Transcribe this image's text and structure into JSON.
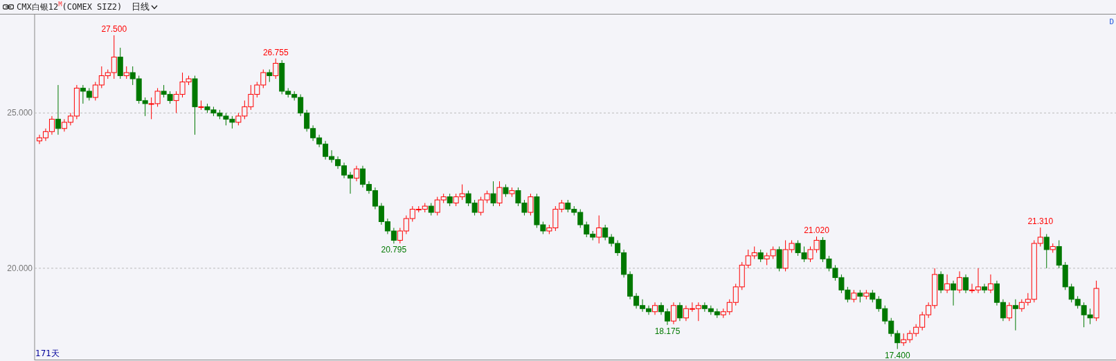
{
  "header": {
    "title": "CMX白银12$^{M}$(COMEX SIZ2)",
    "period": "日线"
  },
  "corner_label": "D",
  "day_count": "171天",
  "chart_data": {
    "type": "candlestick",
    "ylim": [
      17.08,
      28.17
    ],
    "yticks": [
      {
        "value": 25,
        "label": "25.000"
      },
      {
        "value": 20,
        "label": "20.000"
      }
    ],
    "ohlc": [
      [
        24.1,
        24.3,
        24.0,
        24.2
      ],
      [
        24.2,
        24.5,
        24.1,
        24.4
      ],
      [
        24.4,
        24.9,
        24.3,
        24.8
      ],
      [
        24.8,
        25.9,
        24.3,
        24.5
      ],
      [
        24.5,
        24.8,
        24.4,
        24.7
      ],
      [
        24.7,
        25.0,
        24.6,
        24.9
      ],
      [
        24.9,
        25.9,
        24.8,
        25.8
      ],
      [
        25.8,
        25.9,
        25.3,
        25.7
      ],
      [
        25.7,
        25.8,
        25.4,
        25.5
      ],
      [
        25.5,
        26.0,
        25.4,
        25.9
      ],
      [
        25.9,
        26.5,
        25.8,
        26.2
      ],
      [
        26.2,
        26.4,
        26.1,
        26.3
      ],
      [
        26.3,
        27.5,
        26.1,
        26.8
      ],
      [
        26.8,
        27.1,
        26.1,
        26.2
      ],
      [
        26.2,
        26.5,
        26.1,
        26.3
      ],
      [
        26.3,
        26.5,
        25.9,
        26.1
      ],
      [
        26.1,
        26.2,
        25.3,
        25.4
      ],
      [
        25.4,
        25.5,
        24.9,
        25.3
      ],
      [
        25.3,
        25.5,
        24.8,
        25.3
      ],
      [
        25.3,
        25.8,
        25.2,
        25.7
      ],
      [
        25.7,
        25.9,
        25.5,
        25.6
      ],
      [
        25.6,
        25.7,
        25.3,
        25.4
      ],
      [
        25.4,
        25.7,
        25.0,
        25.6
      ],
      [
        25.6,
        26.3,
        25.5,
        26.0
      ],
      [
        26.0,
        26.2,
        25.9,
        26.1
      ],
      [
        26.1,
        26.2,
        24.3,
        25.2
      ],
      [
        25.2,
        25.4,
        25.1,
        25.2
      ],
      [
        25.2,
        25.3,
        25.0,
        25.1
      ],
      [
        25.1,
        25.2,
        24.9,
        25.0
      ],
      [
        25.0,
        25.1,
        24.8,
        24.9
      ],
      [
        24.9,
        25.0,
        24.6,
        24.8
      ],
      [
        24.8,
        24.9,
        24.5,
        24.7
      ],
      [
        24.7,
        25.0,
        24.6,
        24.9
      ],
      [
        24.9,
        25.4,
        24.8,
        25.2
      ],
      [
        25.2,
        25.9,
        25.1,
        25.6
      ],
      [
        25.6,
        26.0,
        25.5,
        25.9
      ],
      [
        25.9,
        26.4,
        25.8,
        26.3
      ],
      [
        26.3,
        26.4,
        26.0,
        26.2
      ],
      [
        26.2,
        26.755,
        26.1,
        26.6
      ],
      [
        26.6,
        26.7,
        25.6,
        25.7
      ],
      [
        25.7,
        25.8,
        25.5,
        25.6
      ],
      [
        25.6,
        25.7,
        25.4,
        25.5
      ],
      [
        25.5,
        25.6,
        24.9,
        25.0
      ],
      [
        25.0,
        25.1,
        24.4,
        24.5
      ],
      [
        24.5,
        24.6,
        24.1,
        24.2
      ],
      [
        24.2,
        24.3,
        23.9,
        24.0
      ],
      [
        24.0,
        24.1,
        23.5,
        23.6
      ],
      [
        23.6,
        23.8,
        23.4,
        23.5
      ],
      [
        23.5,
        23.6,
        23.2,
        23.3
      ],
      [
        23.3,
        23.4,
        22.9,
        23.0
      ],
      [
        23.0,
        23.1,
        22.4,
        22.9
      ],
      [
        22.9,
        23.3,
        22.8,
        23.2
      ],
      [
        23.2,
        23.3,
        22.6,
        22.7
      ],
      [
        22.7,
        22.8,
        22.4,
        22.5
      ],
      [
        22.5,
        22.6,
        21.9,
        22.0
      ],
      [
        22.0,
        22.1,
        21.4,
        21.5
      ],
      [
        21.5,
        21.6,
        21.1,
        21.2
      ],
      [
        21.2,
        21.3,
        20.795,
        20.9
      ],
      [
        20.9,
        21.3,
        20.8,
        21.2
      ],
      [
        21.2,
        21.7,
        21.1,
        21.6
      ],
      [
        21.6,
        22.0,
        21.5,
        21.9
      ],
      [
        21.9,
        22.0,
        21.8,
        21.9
      ],
      [
        21.9,
        22.1,
        21.8,
        22.0
      ],
      [
        22.0,
        22.1,
        21.7,
        21.8
      ],
      [
        21.8,
        22.3,
        21.7,
        22.2
      ],
      [
        22.2,
        22.4,
        22.1,
        22.3
      ],
      [
        22.3,
        22.4,
        22.0,
        22.1
      ],
      [
        22.1,
        22.4,
        22.0,
        22.3
      ],
      [
        22.3,
        22.7,
        22.2,
        22.4
      ],
      [
        22.4,
        22.5,
        22.0,
        22.1
      ],
      [
        22.1,
        22.2,
        21.7,
        21.8
      ],
      [
        21.8,
        22.3,
        21.7,
        22.2
      ],
      [
        22.2,
        22.5,
        22.1,
        22.4
      ],
      [
        22.4,
        22.8,
        22.0,
        22.1
      ],
      [
        22.1,
        22.8,
        22.0,
        22.6
      ],
      [
        22.6,
        22.7,
        22.3,
        22.4
      ],
      [
        22.4,
        22.6,
        22.3,
        22.5
      ],
      [
        22.5,
        22.6,
        22.0,
        22.1
      ],
      [
        22.1,
        22.2,
        21.7,
        21.8
      ],
      [
        21.8,
        22.4,
        21.7,
        22.3
      ],
      [
        22.3,
        22.4,
        21.3,
        21.4
      ],
      [
        21.4,
        21.5,
        21.1,
        21.2
      ],
      [
        21.2,
        21.4,
        21.1,
        21.3
      ],
      [
        21.3,
        22.0,
        21.2,
        21.9
      ],
      [
        21.9,
        22.2,
        21.8,
        22.1
      ],
      [
        22.1,
        22.2,
        21.8,
        21.9
      ],
      [
        21.9,
        22.0,
        21.7,
        21.8
      ],
      [
        21.8,
        21.9,
        21.3,
        21.4
      ],
      [
        21.4,
        21.5,
        21.0,
        21.1
      ],
      [
        21.1,
        21.2,
        20.9,
        21.0
      ],
      [
        21.0,
        21.7,
        20.8,
        21.3
      ],
      [
        21.3,
        21.4,
        20.9,
        21.0
      ],
      [
        21.0,
        21.1,
        20.7,
        20.8
      ],
      [
        20.8,
        20.9,
        20.4,
        20.5
      ],
      [
        20.5,
        20.6,
        19.7,
        19.8
      ],
      [
        19.8,
        19.9,
        19.0,
        19.1
      ],
      [
        19.1,
        19.2,
        18.7,
        18.8
      ],
      [
        18.8,
        19.0,
        18.6,
        18.7
      ],
      [
        18.7,
        18.8,
        18.5,
        18.6
      ],
      [
        18.6,
        18.9,
        18.5,
        18.8
      ],
      [
        18.8,
        18.9,
        18.5,
        18.6
      ],
      [
        18.6,
        18.7,
        18.175,
        18.3
      ],
      [
        18.3,
        18.9,
        18.2,
        18.8
      ],
      [
        18.8,
        18.9,
        18.3,
        18.4
      ],
      [
        18.4,
        18.8,
        18.3,
        18.7
      ],
      [
        18.7,
        18.9,
        18.6,
        18.7
      ],
      [
        18.7,
        18.9,
        18.3,
        18.8
      ],
      [
        18.8,
        18.9,
        18.6,
        18.7
      ],
      [
        18.7,
        18.8,
        18.5,
        18.6
      ],
      [
        18.6,
        18.7,
        18.4,
        18.5
      ],
      [
        18.5,
        18.7,
        18.4,
        18.6
      ],
      [
        18.6,
        19.0,
        18.5,
        18.9
      ],
      [
        18.9,
        19.5,
        18.8,
        19.4
      ],
      [
        19.4,
        20.2,
        19.3,
        20.1
      ],
      [
        20.1,
        20.6,
        20.0,
        20.4
      ],
      [
        20.4,
        20.7,
        20.3,
        20.5
      ],
      [
        20.5,
        20.6,
        20.2,
        20.3
      ],
      [
        20.3,
        20.5,
        20.1,
        20.4
      ],
      [
        20.4,
        20.7,
        20.3,
        20.6
      ],
      [
        20.6,
        20.7,
        19.9,
        20.0
      ],
      [
        20.0,
        20.9,
        19.9,
        20.6
      ],
      [
        20.6,
        20.9,
        20.5,
        20.8
      ],
      [
        20.8,
        20.9,
        20.4,
        20.5
      ],
      [
        20.5,
        20.7,
        20.2,
        20.3
      ],
      [
        20.3,
        20.7,
        20.2,
        20.6
      ],
      [
        20.6,
        21.02,
        20.5,
        20.9
      ],
      [
        20.9,
        21.0,
        20.2,
        20.3
      ],
      [
        20.3,
        20.4,
        19.9,
        20.0
      ],
      [
        20.0,
        20.1,
        19.6,
        19.7
      ],
      [
        19.7,
        19.8,
        19.2,
        19.3
      ],
      [
        19.3,
        19.4,
        18.9,
        19.0
      ],
      [
        19.0,
        19.3,
        18.9,
        19.2
      ],
      [
        19.2,
        19.3,
        18.9,
        19.1
      ],
      [
        19.1,
        19.3,
        19.0,
        19.2
      ],
      [
        19.2,
        19.3,
        18.9,
        19.0
      ],
      [
        19.0,
        19.1,
        18.6,
        18.7
      ],
      [
        18.7,
        18.8,
        18.2,
        18.3
      ],
      [
        18.3,
        18.4,
        17.8,
        17.9
      ],
      [
        17.9,
        18.0,
        17.4,
        17.6
      ],
      [
        17.6,
        17.9,
        17.5,
        17.7
      ],
      [
        17.7,
        18.0,
        17.6,
        17.9
      ],
      [
        17.9,
        18.2,
        17.8,
        18.1
      ],
      [
        18.1,
        18.6,
        18.0,
        18.5
      ],
      [
        18.5,
        18.9,
        18.4,
        18.8
      ],
      [
        18.8,
        20.0,
        18.7,
        19.8
      ],
      [
        19.8,
        19.9,
        19.2,
        19.3
      ],
      [
        19.3,
        19.8,
        19.2,
        19.5
      ],
      [
        19.5,
        19.6,
        18.8,
        19.3
      ],
      [
        19.3,
        19.9,
        19.2,
        19.7
      ],
      [
        19.7,
        19.8,
        19.2,
        19.3
      ],
      [
        19.3,
        19.5,
        19.2,
        19.3
      ],
      [
        19.3,
        20.0,
        19.2,
        19.4
      ],
      [
        19.4,
        19.5,
        19.2,
        19.3
      ],
      [
        19.3,
        19.8,
        19.2,
        19.5
      ],
      [
        19.5,
        19.6,
        18.8,
        18.9
      ],
      [
        18.9,
        19.0,
        18.3,
        18.4
      ],
      [
        18.4,
        18.9,
        18.3,
        18.8
      ],
      [
        18.8,
        19.0,
        18.0,
        18.7
      ],
      [
        18.7,
        19.0,
        18.6,
        18.9
      ],
      [
        18.9,
        19.2,
        18.8,
        19.0
      ],
      [
        19.0,
        20.9,
        18.9,
        20.8
      ],
      [
        20.8,
        21.31,
        20.7,
        21.0
      ],
      [
        21.0,
        21.1,
        20.0,
        20.6
      ],
      [
        20.6,
        20.8,
        20.5,
        20.7
      ],
      [
        20.7,
        20.9,
        20.0,
        20.1
      ],
      [
        20.1,
        20.2,
        19.3,
        19.4
      ],
      [
        19.4,
        19.5,
        18.9,
        19.0
      ],
      [
        19.0,
        19.1,
        18.7,
        18.8
      ],
      [
        18.8,
        18.9,
        18.1,
        18.5
      ],
      [
        18.5,
        18.7,
        18.2,
        18.4
      ],
      [
        18.4,
        19.6,
        18.3,
        19.35
      ]
    ],
    "annotations": [
      {
        "text": "27.500",
        "y": 27.5
      },
      {
        "text": "26.755",
        "y": 26.755
      },
      {
        "text": "20.795",
        "y": 20.795
      },
      {
        "text": "18.175",
        "y": 18.175
      },
      {
        "text": "21.020",
        "y": 21.02
      },
      {
        "text": "17.400",
        "y": 17.4
      },
      {
        "text": "21.310",
        "y": 21.31
      }
    ]
  }
}
